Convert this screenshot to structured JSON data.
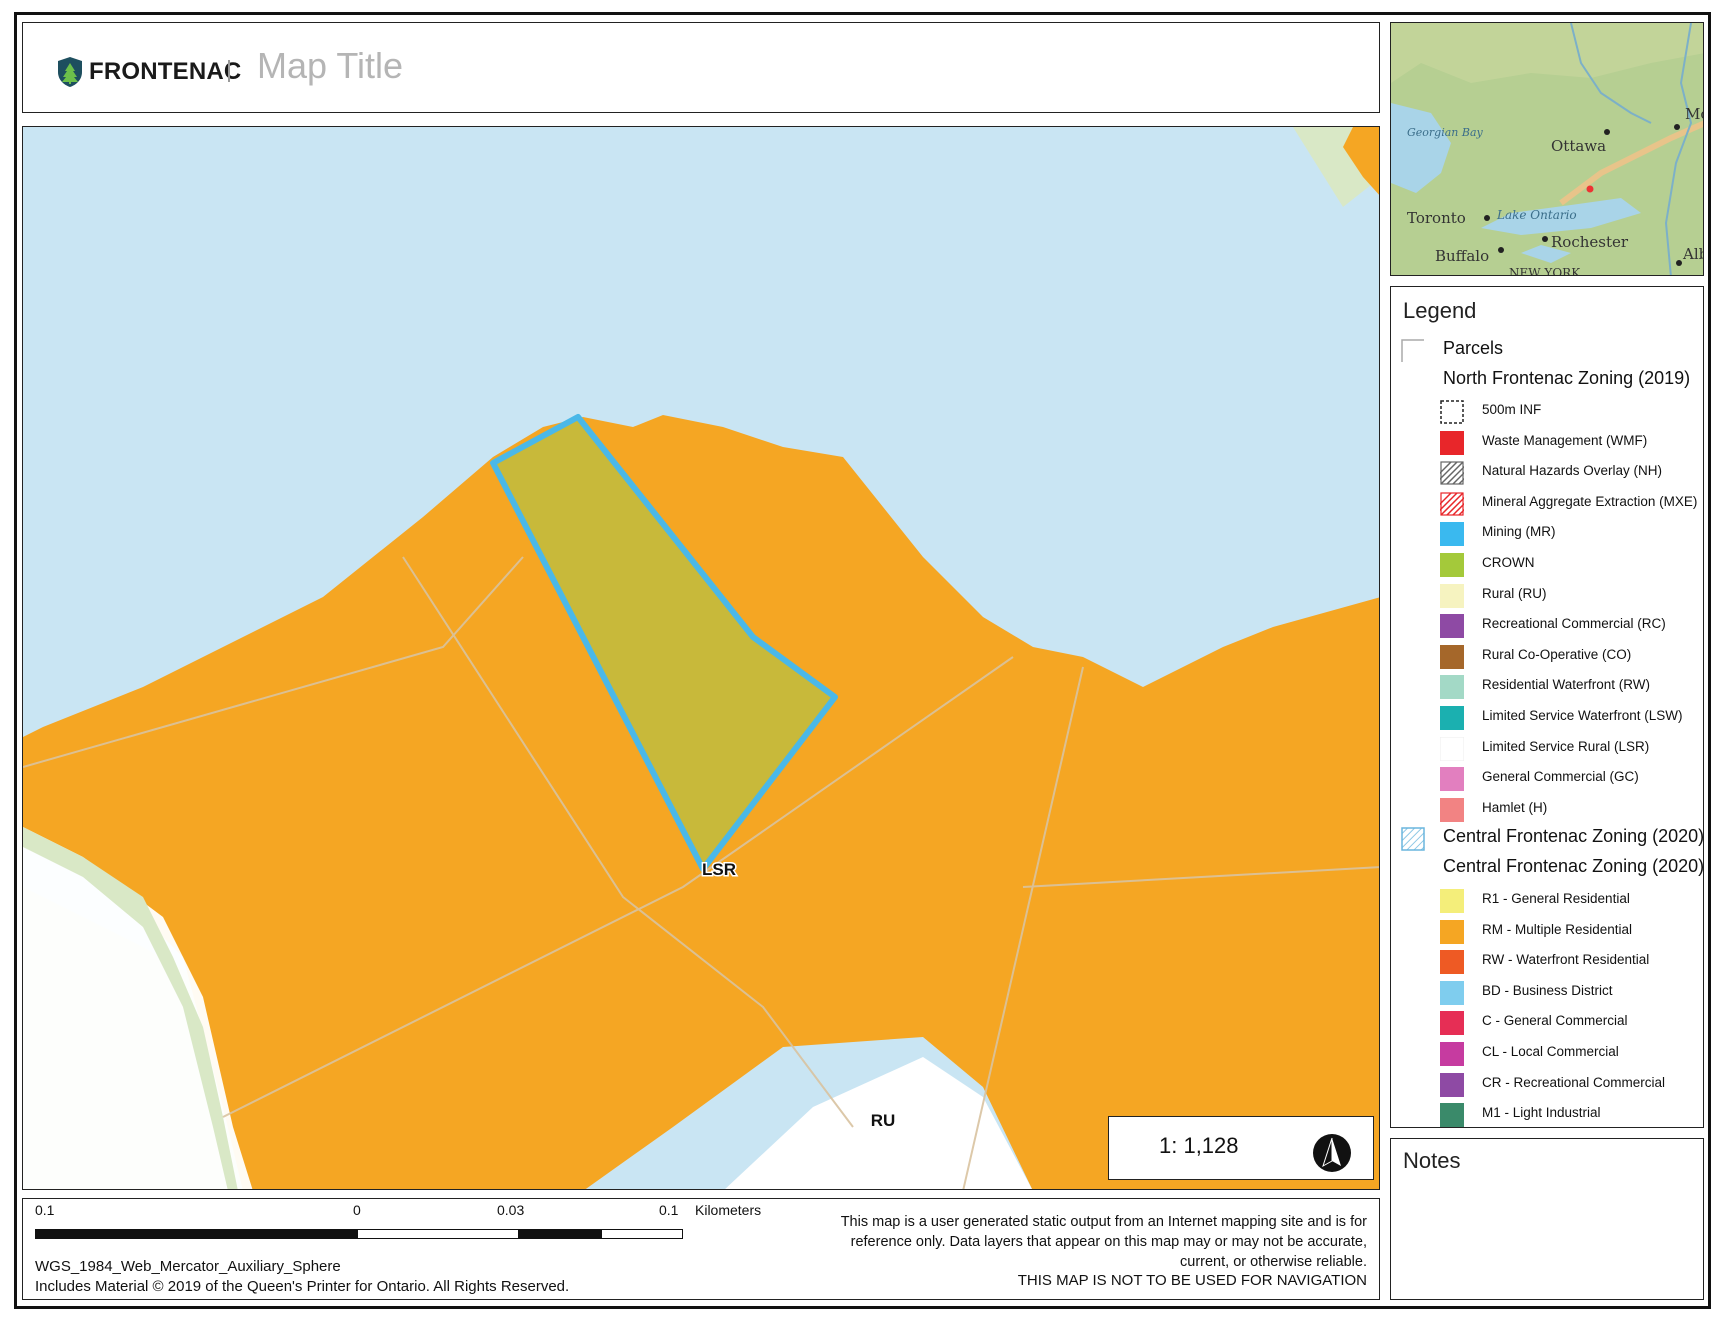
{
  "header": {
    "brand_name": "FRONTENAC",
    "map_title": "Map Title"
  },
  "map": {
    "zone_labels": {
      "lsr": "LSR",
      "ru": "RU"
    },
    "scale_text": "1: 1,128",
    "colors": {
      "water": "#c9e5f3",
      "zone_rm": "#f5a623",
      "crown_fill": "#c8b93a",
      "parcel_outline": "#4ab8e8",
      "rural_green": "#d9e8c6",
      "parcel_lines": "#d9c3a0"
    }
  },
  "inset": {
    "places": {
      "georgian_bay": "Georgian Bay",
      "ottawa": "Ottawa",
      "toronto": "Toronto",
      "lake_ontario": "Lake Ontario",
      "rochester": "Rochester",
      "buffalo": "Buffalo",
      "new_york": "NEW YORK",
      "mo": "Mo",
      "alb": "Alb"
    }
  },
  "legend": {
    "title": "Legend",
    "parcels_label": "Parcels",
    "north_heading": "North Frontenac Zoning (2019)",
    "north_items": [
      {
        "label": "500m INF",
        "color": "#ffffff",
        "style": "dashed"
      },
      {
        "label": "Waste Management (WMF)",
        "color": "#e8262a",
        "style": "solid"
      },
      {
        "label": "Natural Hazards Overlay (NH)",
        "color": "#666666",
        "style": "hatch"
      },
      {
        "label": "Mineral Aggregate Extraction (MXE)",
        "color": "#e8262a",
        "style": "hatch"
      },
      {
        "label": "Mining (MR)",
        "color": "#3ab9ef",
        "style": "solid"
      },
      {
        "label": "CROWN",
        "color": "#a4c93a",
        "style": "solid"
      },
      {
        "label": "Rural (RU)",
        "color": "#f6f3c0",
        "style": "solid"
      },
      {
        "label": "Recreational Commercial (RC)",
        "color": "#8e4aa4",
        "style": "solid"
      },
      {
        "label": "Rural Co-Operative (CO)",
        "color": "#a5672a",
        "style": "solid"
      },
      {
        "label": "Residential Waterfront (RW)",
        "color": "#a3d9c6",
        "style": "solid"
      },
      {
        "label": "Limited Service Waterfront (LSW)",
        "color": "#1bb0b0",
        "style": "solid"
      },
      {
        "label": "Limited Service Rural (LSR)",
        "color": "#ffffff",
        "style": "solid"
      },
      {
        "label": "General Commercial (GC)",
        "color": "#e27fbf",
        "style": "solid"
      },
      {
        "label": "Hamlet (H)",
        "color": "#f28383",
        "style": "solid"
      }
    ],
    "central_heading_1": "Central Frontenac Zoning (2020)",
    "central_heading_2": "Central Frontenac Zoning (2020)",
    "central_items": [
      {
        "label": "R1 - General Residential",
        "color": "#f4ee7a",
        "style": "solid"
      },
      {
        "label": "RM - Multiple Residential",
        "color": "#f5a623",
        "style": "solid"
      },
      {
        "label": "RW - Waterfront Residential",
        "color": "#ee5a24",
        "style": "solid"
      },
      {
        "label": "BD - Business District",
        "color": "#7fcdee",
        "style": "solid"
      },
      {
        "label": "C - General Commercial",
        "color": "#e62e55",
        "style": "solid"
      },
      {
        "label": "CL - Local Commercial",
        "color": "#c63ba0",
        "style": "solid"
      },
      {
        "label": "CR - Recreational Commercial",
        "color": "#8e4aa4",
        "style": "solid"
      },
      {
        "label": "M1 - Light Industrial",
        "color": "#3a8a6a",
        "style": "solid"
      }
    ]
  },
  "notes": {
    "title": "Notes"
  },
  "footer": {
    "scale_labels": [
      "0.1",
      "0",
      "0.03",
      "0.1",
      "Kilometers"
    ],
    "projection": "WGS_1984_Web_Mercator_Auxiliary_Sphere",
    "copyright": "Includes Material © 2019 of the Queen's Printer for Ontario. All Rights Reserved.",
    "disclaimer": "This map is a user generated static output from an Internet mapping site and is for reference only. Data layers that appear on this map may or may not be accurate, current, or otherwise reliable.",
    "navigation_warning": "THIS MAP IS NOT TO BE USED FOR NAVIGATION"
  }
}
